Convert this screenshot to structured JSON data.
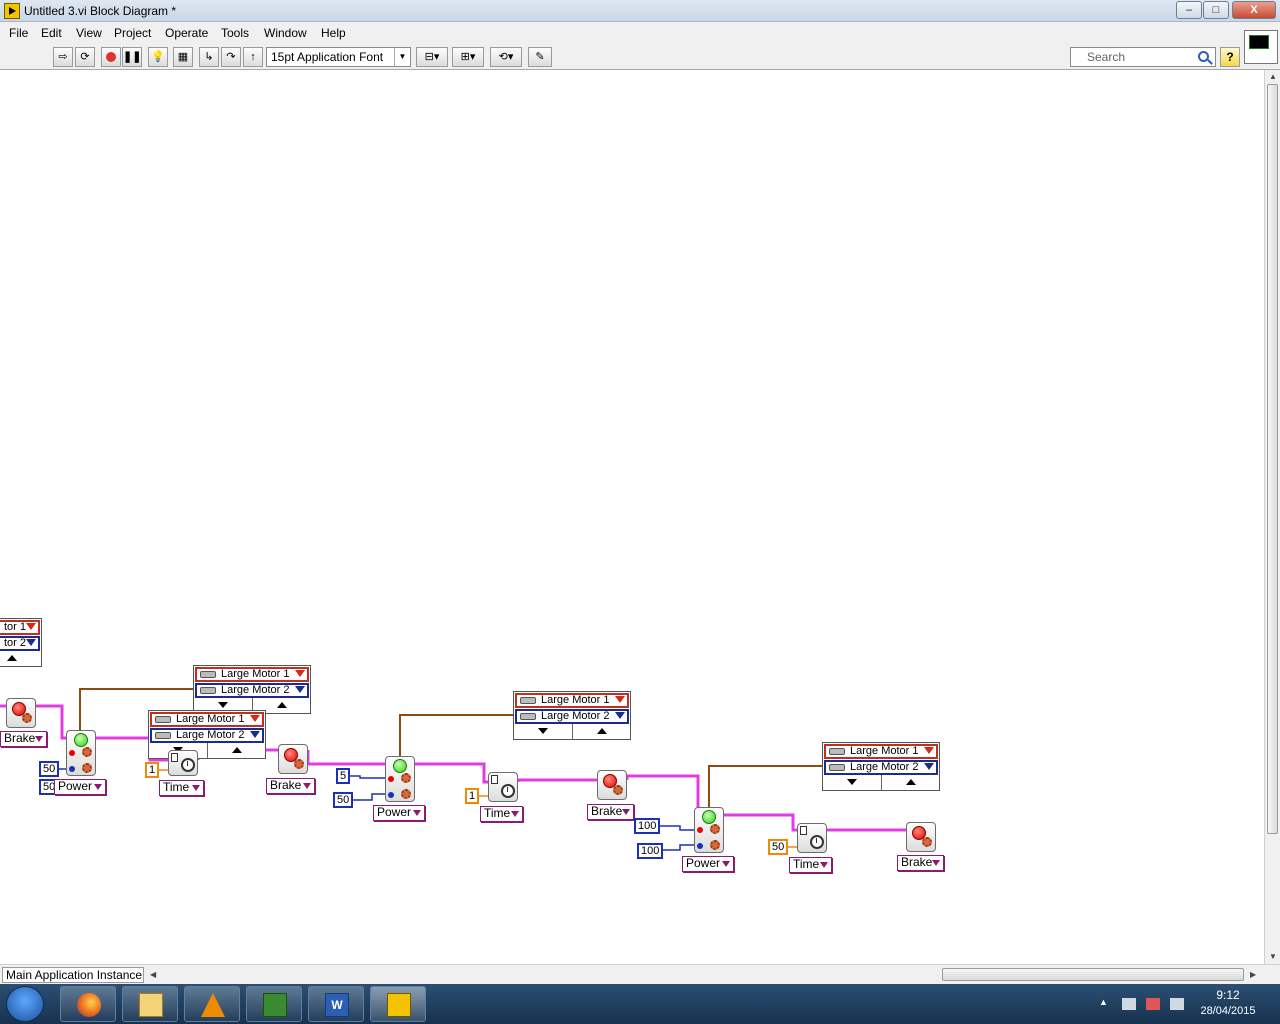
{
  "window": {
    "title": "Untitled 3.vi Block Diagram *",
    "controls": {
      "minimize": "–",
      "maximize": "□",
      "close": "X"
    }
  },
  "menu": [
    "File",
    "Edit",
    "View",
    "Project",
    "Operate",
    "Tools",
    "Window",
    "Help"
  ],
  "toolbar": {
    "font": "15pt Application Font",
    "search_placeholder": "Search",
    "help": "?"
  },
  "diagram": {
    "motor_label_1": "Large Motor 1",
    "motor_label_2": "Large Motor 2",
    "partial_motor_1": "tor 1",
    "partial_motor_2": "tor 2",
    "modes": {
      "brake": "Brake",
      "power": "Power",
      "time": "Time"
    },
    "blocks": [
      {
        "mode": "Brake"
      },
      {
        "mode": "Power",
        "inputs": [
          "50",
          "50"
        ]
      },
      {
        "mode": "Time",
        "input": "1"
      },
      {
        "mode": "Brake"
      },
      {
        "mode": "Power",
        "inputs": [
          "5",
          "50"
        ]
      },
      {
        "mode": "Time",
        "input": "1"
      },
      {
        "mode": "Brake"
      },
      {
        "mode": "Power",
        "inputs": [
          "100",
          "100"
        ]
      },
      {
        "mode": "Time",
        "input": "50"
      },
      {
        "mode": "Brake"
      }
    ],
    "wire_colors": {
      "motor_ref": "#8a4b14",
      "sequence": "#e23be6"
    }
  },
  "status": {
    "instance": "Main Application Instance"
  },
  "taskbar": {
    "apps": [
      "firefox",
      "file-explorer",
      "vlc",
      "project",
      "word",
      "labview"
    ],
    "time": "9:12",
    "date": "28/04/2015"
  }
}
